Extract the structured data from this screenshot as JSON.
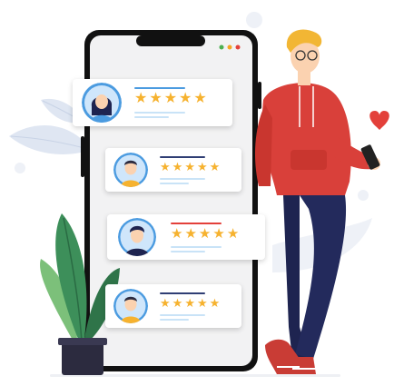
{
  "illustration": {
    "subject": "customer reviews on smartphone",
    "colors": {
      "phone_frame": "#111111",
      "phone_screen": "#f2f2f3",
      "leaf_blue": "#dfe6f2",
      "plant_green": "#3d8f5a",
      "plant_dark": "#2f7449",
      "pot": "#2c2b3f",
      "hoodie": "#d9403a",
      "pants": "#1e2450",
      "hair": "#f2b634",
      "heart": "#e3403a",
      "star": "#f6b22f",
      "skin": "#fbd2b0"
    },
    "reviews": [
      {
        "stars": 5,
        "rating_shown": 5,
        "accent": "#4b9be0",
        "avatar": "woman-avatar"
      },
      {
        "stars": 5,
        "rating_shown": 5,
        "accent": "#2f3e74",
        "avatar": "man-avatar"
      },
      {
        "stars": 5,
        "rating_shown": 5,
        "accent": "#e3403a",
        "avatar": "man-dark-hair-avatar"
      },
      {
        "stars": 5,
        "rating_shown": 5,
        "accent": "#2f3e74",
        "avatar": "man-avatar"
      }
    ],
    "icons": {
      "star": "★",
      "heart": "heart-icon"
    }
  }
}
